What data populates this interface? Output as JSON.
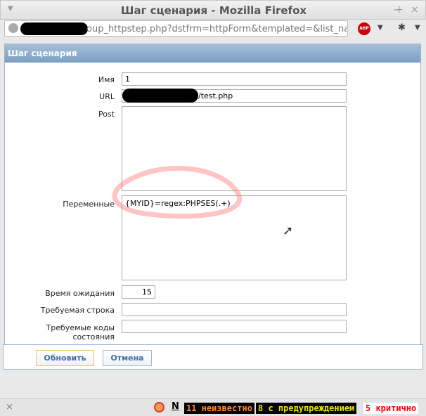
{
  "window": {
    "title": "Шаг сценария - Mozilla Firefox",
    "minimize": "–",
    "maximize": "+",
    "close": "×"
  },
  "browser": {
    "url": "oup_httpstep.php?dstfrm=httpForm&templated=&list_name=",
    "abp": "ABP"
  },
  "panel": {
    "title": "Шаг сценария"
  },
  "form": {
    "name_label": "Имя",
    "name_value": "1",
    "url_label": "URL",
    "url_value": "/test.php",
    "post_label": "Post",
    "post_value": "",
    "vars_label": "Переменные",
    "vars_value": "{MYID}=regex:PHPSES(.+)",
    "timeout_label": "Время ожидания",
    "timeout_value": "15",
    "required_label": "Требуемая строка",
    "required_value": "",
    "codes_label": "Требуемые коды состояния",
    "codes_value": ""
  },
  "buttons": {
    "update": "Обновить",
    "cancel": "Отмена"
  },
  "status": {
    "close": "×",
    "n": "N",
    "unknown": "11 неизвестно",
    "warning": "8 с предупреждением",
    "critical": "5 критично",
    "colors": {
      "unknown": "#ff8a2a",
      "warning": "#e8e800",
      "critical": "#ff0000"
    }
  }
}
